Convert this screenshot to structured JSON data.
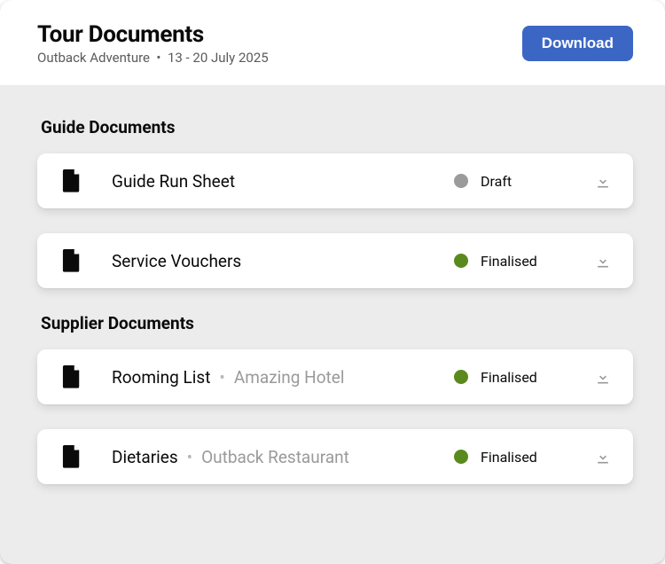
{
  "header": {
    "title": "Tour Documents",
    "tour_name": "Outback Adventure",
    "date_range": "13 - 20 July 2025",
    "download_label": "Download"
  },
  "status_colors": {
    "Draft": "#9b9b9b",
    "Finalised": "#5a8a1e"
  },
  "sections": [
    {
      "title": "Guide Documents",
      "documents": [
        {
          "name": "Guide Run Sheet",
          "supplier": null,
          "status": "Draft"
        },
        {
          "name": "Service Vouchers",
          "supplier": null,
          "status": "Finalised"
        }
      ]
    },
    {
      "title": "Supplier Documents",
      "documents": [
        {
          "name": "Rooming List",
          "supplier": "Amazing Hotel",
          "status": "Finalised"
        },
        {
          "name": "Dietaries",
          "supplier": "Outback Restaurant",
          "status": "Finalised"
        }
      ]
    }
  ]
}
